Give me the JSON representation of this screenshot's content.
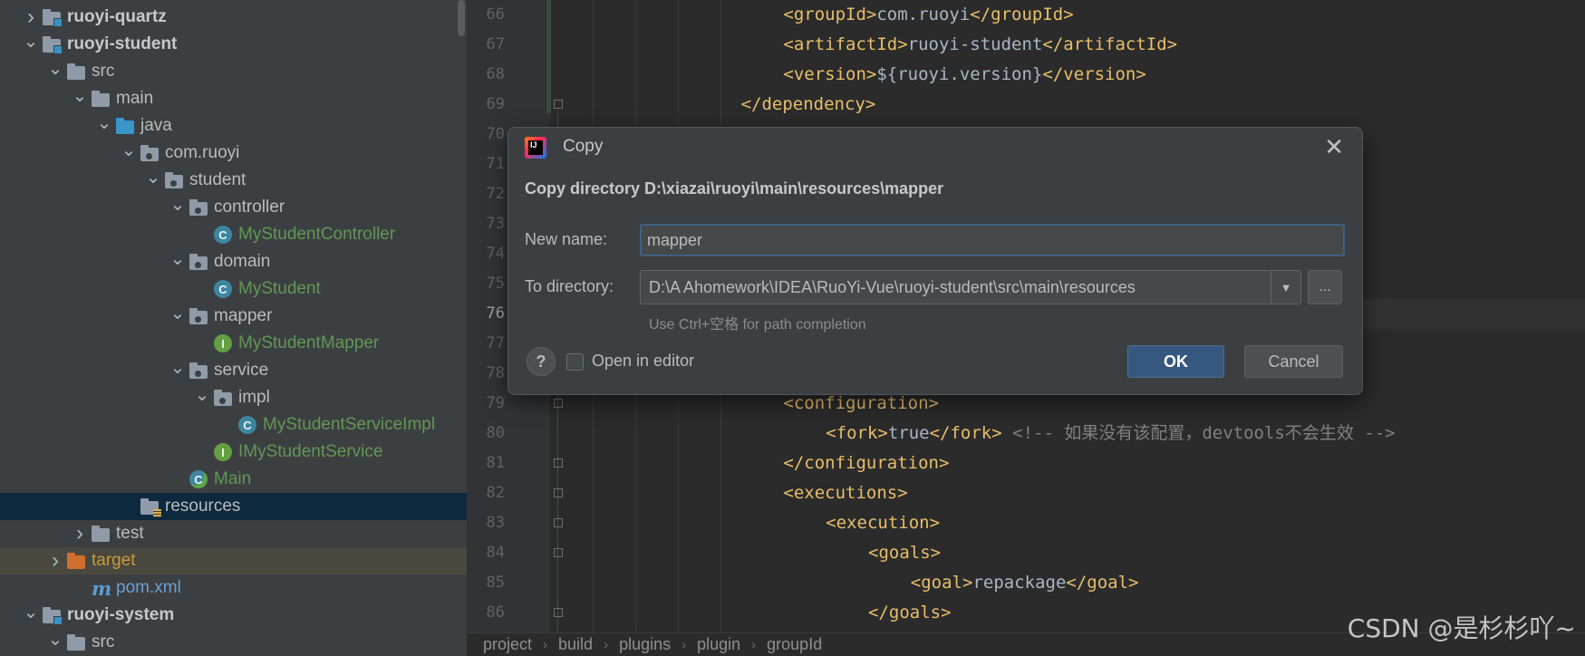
{
  "tree": {
    "items": [
      {
        "label": "ruoyi-quartz",
        "style": "bold",
        "icon": "module-folder-icon",
        "chev": ">"
      },
      {
        "label": "ruoyi-student",
        "style": "bold",
        "icon": "module-folder-icon",
        "chev": "v"
      },
      {
        "label": "src",
        "icon": "folder-icon",
        "chev": "v"
      },
      {
        "label": "main",
        "icon": "folder-icon",
        "chev": "v"
      },
      {
        "label": "java",
        "icon": "source-folder-icon",
        "chev": "v"
      },
      {
        "label": "com.ruoyi",
        "icon": "package-icon",
        "chev": "v"
      },
      {
        "label": "student",
        "icon": "package-icon",
        "chev": "v"
      },
      {
        "label": "controller",
        "icon": "package-icon",
        "chev": "v"
      },
      {
        "label": "MyStudentController",
        "style": "green",
        "icon": "class-icon",
        "chev": ""
      },
      {
        "label": "domain",
        "icon": "package-icon",
        "chev": "v"
      },
      {
        "label": "MyStudent",
        "style": "green",
        "icon": "class-icon",
        "chev": ""
      },
      {
        "label": "mapper",
        "icon": "package-icon",
        "chev": "v"
      },
      {
        "label": "MyStudentMapper",
        "style": "green",
        "icon": "interface-icon",
        "chev": ""
      },
      {
        "label": "service",
        "icon": "package-icon",
        "chev": "v"
      },
      {
        "label": "impl",
        "icon": "package-icon",
        "chev": "v"
      },
      {
        "label": "MyStudentServiceImpl",
        "style": "green",
        "icon": "class-icon",
        "chev": ""
      },
      {
        "label": "IMyStudentService",
        "style": "green",
        "icon": "interface-icon",
        "chev": ""
      },
      {
        "label": "Main",
        "style": "green",
        "icon": "main-class-icon",
        "chev": ""
      },
      {
        "label": "resources",
        "icon": "resources-folder-icon",
        "chev": "",
        "selected": true
      },
      {
        "label": "test",
        "icon": "folder-icon",
        "chev": ">"
      },
      {
        "label": "target",
        "style": "target",
        "icon": "excluded-folder-icon",
        "chev": ">"
      },
      {
        "label": "pom.xml",
        "style": "blue",
        "icon": "maven-icon",
        "chev": ""
      },
      {
        "label": "ruoyi-system",
        "style": "bold",
        "icon": "module-folder-icon",
        "chev": "v"
      },
      {
        "label": "src",
        "icon": "folder-icon",
        "chev": "v"
      }
    ]
  },
  "editor": {
    "line_numbers": [
      "66",
      "67",
      "68",
      "69",
      "70",
      "71",
      "72",
      "73",
      "74",
      "75",
      "76",
      "77",
      "78",
      "79",
      "80",
      "81",
      "82",
      "83",
      "84",
      "85",
      "86"
    ],
    "active_line": "76",
    "lines": [
      {
        "n": "66",
        "parts": [
          [
            "tag",
            "<groupId>"
          ],
          [
            "txt",
            "com.ruoyi"
          ],
          [
            "tag",
            "</groupId>"
          ]
        ]
      },
      {
        "n": "67",
        "parts": [
          [
            "tag",
            "<artifactId>"
          ],
          [
            "txt",
            "ruoyi-student"
          ],
          [
            "tag",
            "</artifactId>"
          ]
        ]
      },
      {
        "n": "68",
        "parts": [
          [
            "tag",
            "<version>"
          ],
          [
            "txt",
            "${ruoyi.version}"
          ],
          [
            "tag",
            "</version>"
          ]
        ]
      },
      {
        "n": "69",
        "parts": [
          [
            "tag",
            "</dependency>"
          ]
        ]
      },
      {
        "n": "79",
        "parts": [
          [
            "tag",
            "<configuration>"
          ]
        ]
      },
      {
        "n": "80",
        "parts": [
          [
            "tag",
            "<fork>"
          ],
          [
            "txt",
            "true"
          ],
          [
            "tag",
            "</fork>"
          ],
          [
            "txt",
            " "
          ],
          [
            "cmt",
            "<!-- 如果没有该配置，devtools不会生效 -->"
          ]
        ]
      },
      {
        "n": "81",
        "parts": [
          [
            "tag",
            "</configuration>"
          ]
        ]
      },
      {
        "n": "82",
        "parts": [
          [
            "tag",
            "<executions>"
          ]
        ]
      },
      {
        "n": "83",
        "parts": [
          [
            "tag",
            "<execution>"
          ]
        ]
      },
      {
        "n": "84",
        "parts": [
          [
            "tag",
            "<goals>"
          ]
        ]
      },
      {
        "n": "85",
        "parts": [
          [
            "tag",
            "<goal>"
          ],
          [
            "txt",
            "repackage"
          ],
          [
            "tag",
            "</goal>"
          ]
        ]
      },
      {
        "n": "86",
        "parts": [
          [
            "tag",
            "</goals>"
          ]
        ]
      }
    ]
  },
  "breadcrumbs": [
    "project",
    "build",
    "plugins",
    "plugin",
    "groupId"
  ],
  "dialog": {
    "title": "Copy",
    "heading": "Copy directory D:\\xiazai\\ruoyi\\main\\resources\\mapper",
    "new_name_label": "New name:",
    "new_name_value": "mapper",
    "to_directory_label": "To directory:",
    "to_directory_value": "D:\\A Ahomework\\IDEA\\RuoYi-Vue\\ruoyi-student\\src\\main\\resources",
    "browse_label": "...",
    "hint": "Use Ctrl+空格 for path completion",
    "help_label": "?",
    "open_in_editor_label": "Open in editor",
    "open_in_editor_checked": false,
    "ok_label": "OK",
    "cancel_label": "Cancel"
  },
  "watermark": "CSDN @是杉杉吖~",
  "colors": {
    "tag": "#e8bf6a",
    "text": "#a9b7c6",
    "comment": "#808080",
    "ok_button": "#365880",
    "selection": "#0d293e"
  }
}
